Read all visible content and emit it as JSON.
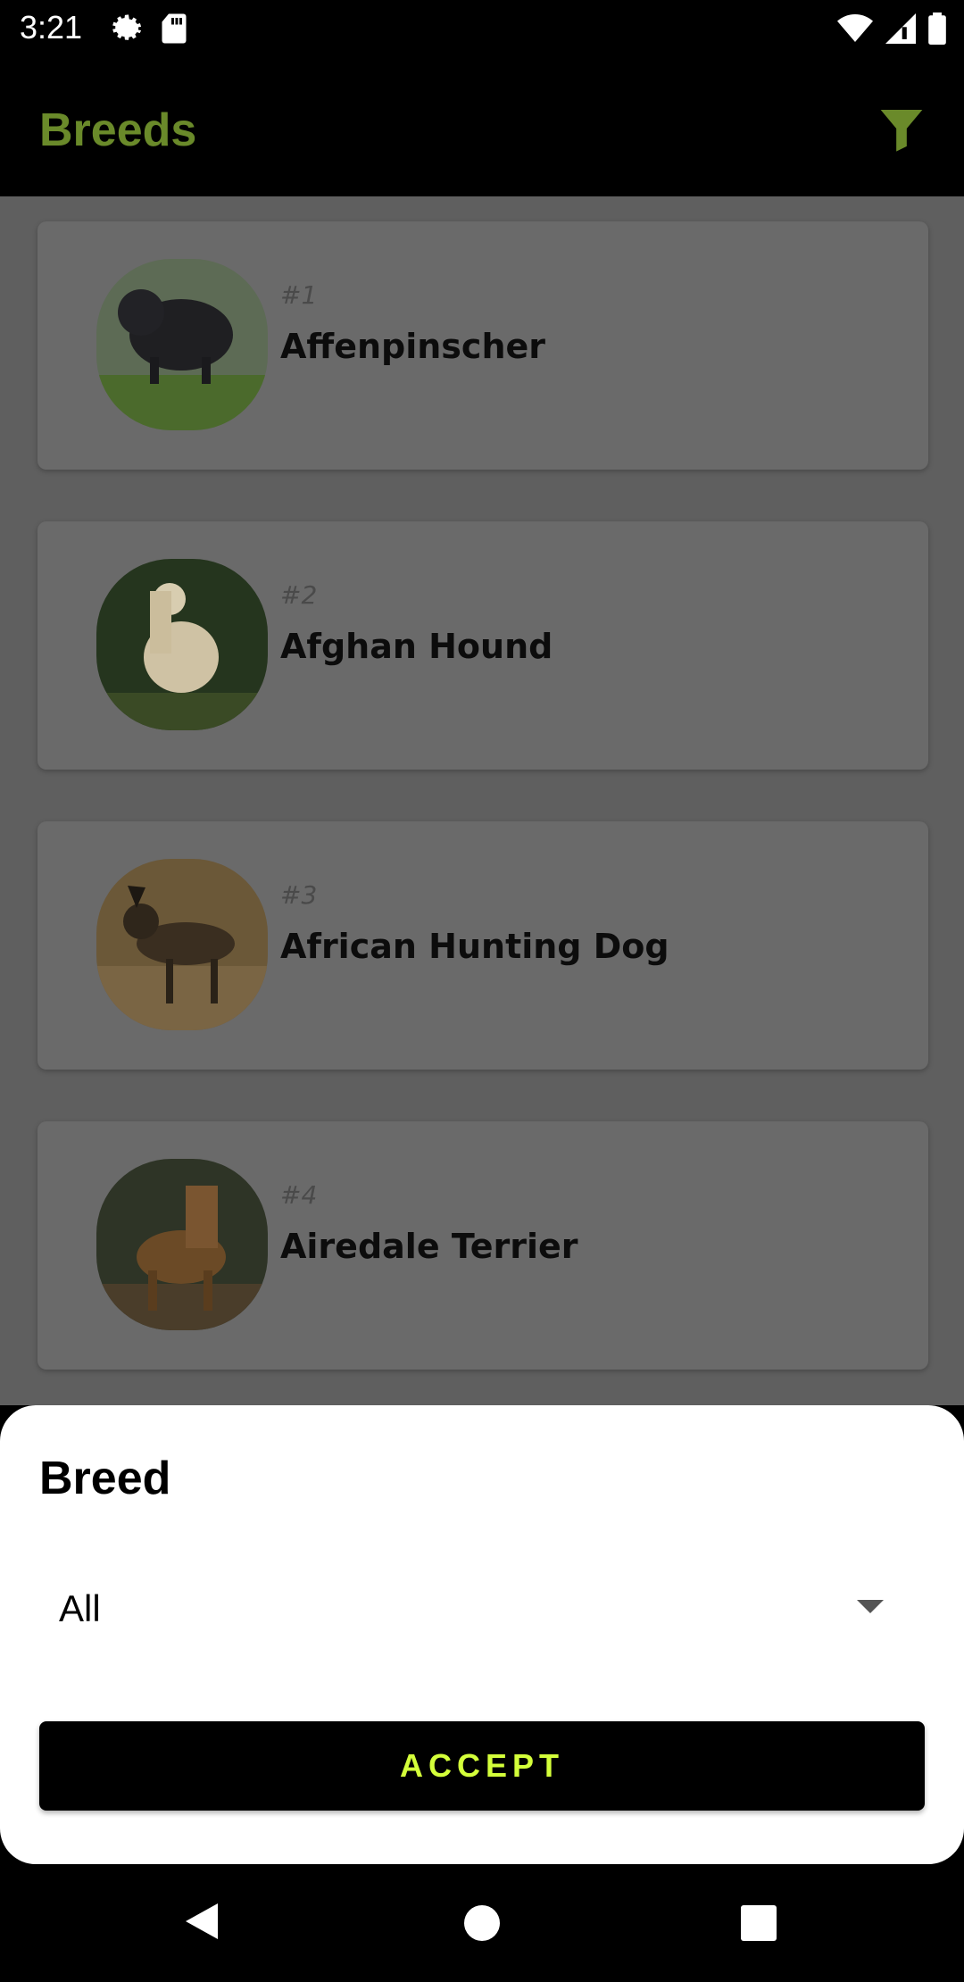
{
  "status_bar": {
    "time": "3:21",
    "icons": [
      "gear-icon",
      "sd-card-icon",
      "wifi-icon",
      "signal-icon",
      "battery-icon"
    ]
  },
  "app_bar": {
    "title": "Breeds",
    "action_icon": "filter-icon",
    "title_color": "#6a8a2a"
  },
  "breeds": [
    {
      "number": "#1",
      "name": "Affenpinscher"
    },
    {
      "number": "#2",
      "name": "Afghan Hound"
    },
    {
      "number": "#3",
      "name": "African Hunting Dog"
    },
    {
      "number": "#4",
      "name": "Airedale Terrier"
    }
  ],
  "filter_sheet": {
    "title": "Breed",
    "selected_value": "All",
    "accept_label": "ACCEPT",
    "accent_color": "#d4ff3a"
  },
  "nav_bar": {
    "icons": [
      "back-icon",
      "home-icon",
      "recent-apps-icon"
    ]
  }
}
